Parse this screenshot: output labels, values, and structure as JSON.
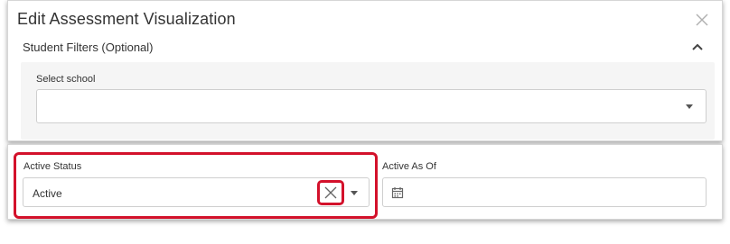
{
  "dialog": {
    "title": "Edit Assessment Visualization"
  },
  "student_filters": {
    "header": "Student Filters (Optional)",
    "school": {
      "label": "Select school",
      "value": ""
    }
  },
  "active_status": {
    "label": "Active Status",
    "value": "Active"
  },
  "active_as_of": {
    "label": "Active As Of",
    "value": ""
  },
  "colors": {
    "highlight": "#d3112b",
    "panel_bg": "#f5f5f5",
    "border": "#cfcfcf"
  },
  "icons": [
    "close-icon",
    "chevron-up-icon",
    "caret-down-icon",
    "clear-icon",
    "calendar-icon"
  ]
}
